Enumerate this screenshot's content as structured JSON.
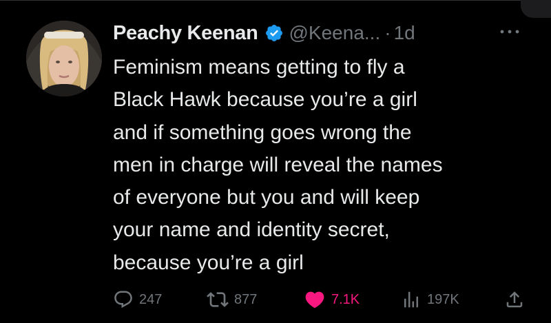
{
  "tweet": {
    "author": {
      "display_name": "Peachy Keenan",
      "handle": "@Keena...",
      "verified": true,
      "avatar_icon": "avatar-photo"
    },
    "separator": "·",
    "timestamp": "1d",
    "text_lines": [
      "Feminism means getting to fly a",
      "Black Hawk because you’re a girl",
      "and if something goes wrong the",
      "men in charge will reveal the names",
      "of everyone but you and will keep",
      "your name and identity secret,",
      "because you’re a girl"
    ],
    "actions": {
      "replies": "247",
      "reposts": "877",
      "likes": "7.1K",
      "views": "197K"
    }
  },
  "colors": {
    "background": "#000000",
    "text": "#e7e9ea",
    "muted": "#71767b",
    "verified_blue": "#1d9bf0",
    "like_pink": "#f91880"
  },
  "icons": {
    "verified": "verified-badge-icon",
    "more": "more-icon",
    "reply": "reply-icon",
    "repost": "repost-icon",
    "like": "heart-icon",
    "views": "views-icon",
    "share": "share-icon"
  }
}
